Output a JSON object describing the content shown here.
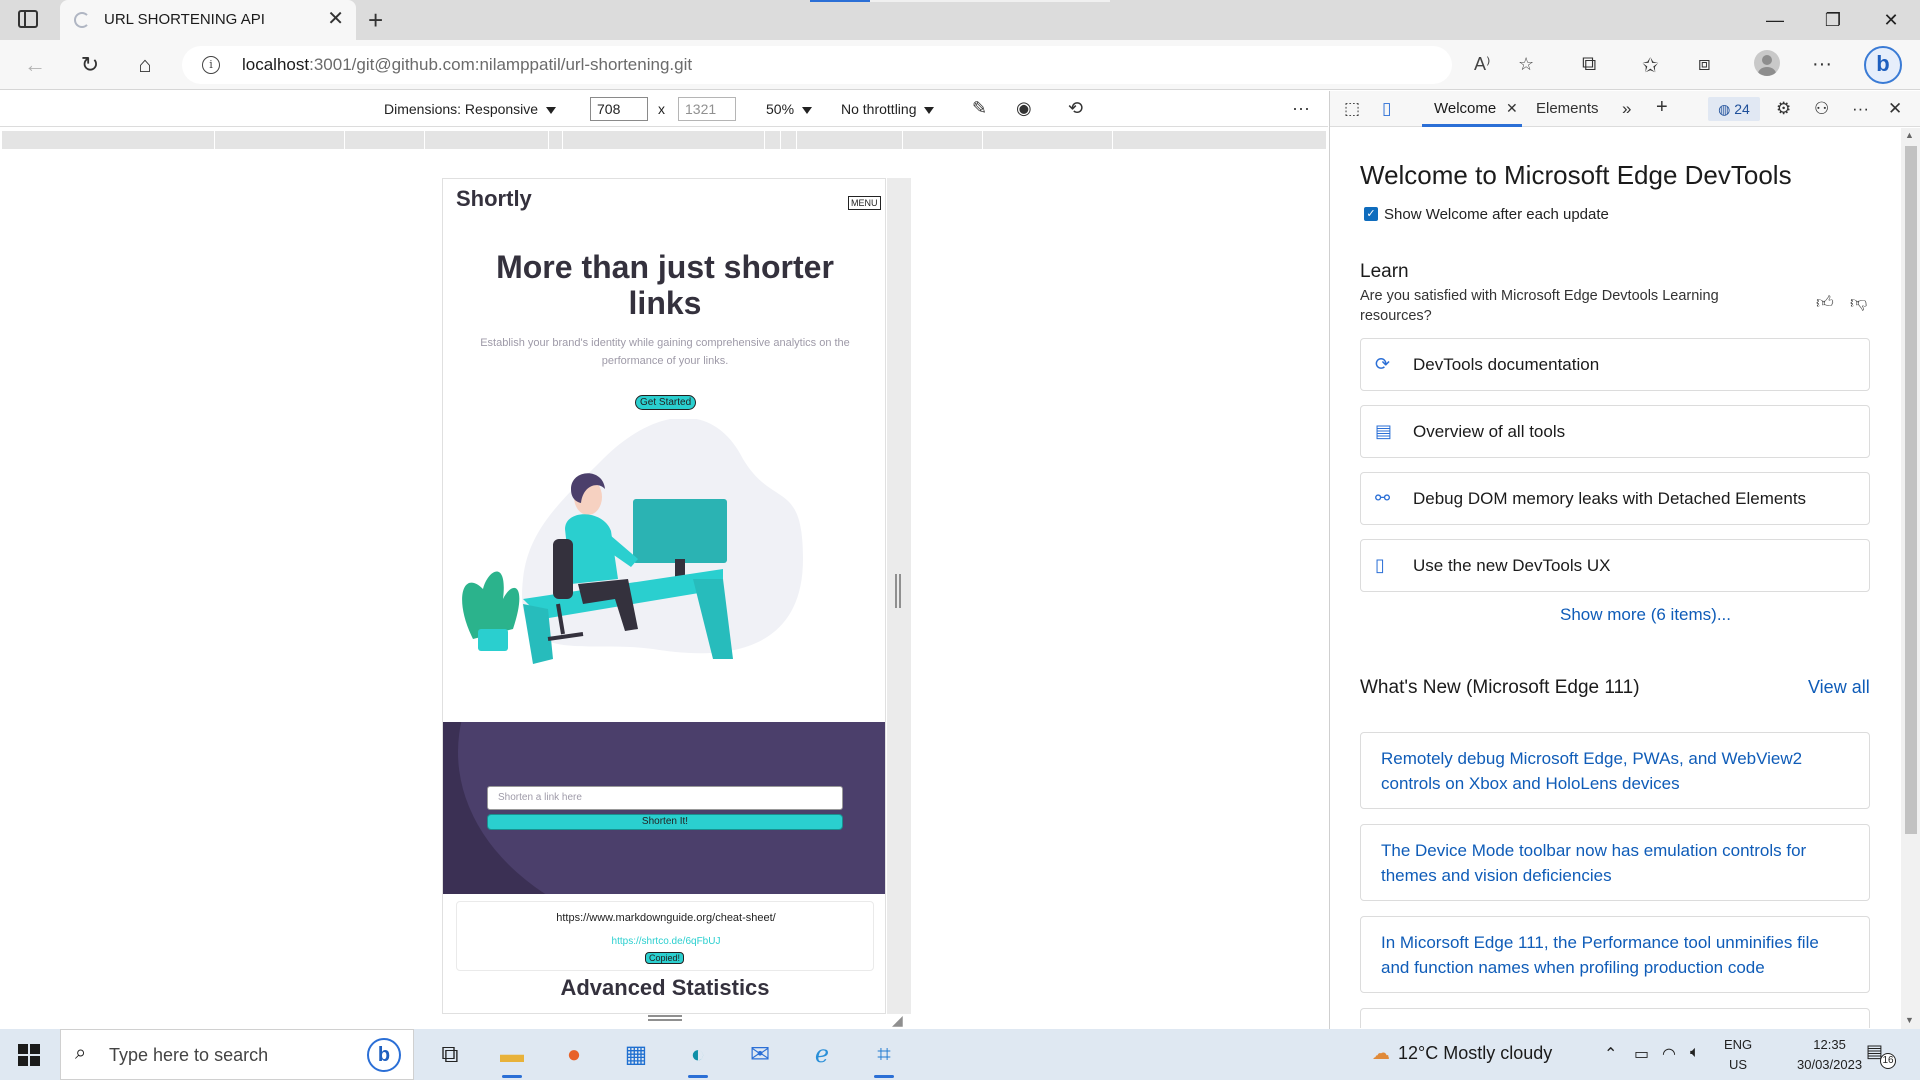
{
  "browser": {
    "tab_title": "URL SHORTENING API",
    "url_host": "localhost",
    "url_rest": ":3001/git@github.com:nilamppatil/url-shortening.git"
  },
  "device_toolbar": {
    "dimensions_label": "Dimensions: Responsive",
    "width": "708",
    "height": "1321",
    "zoom": "50%",
    "throttling": "No throttling"
  },
  "page": {
    "logo": "Shortly",
    "menu_label": "MENU",
    "hero_title": "More than just shorter links",
    "hero_subtitle": "Establish your brand's identity while gaining comprehensive analytics on the performance of your links.",
    "get_started": "Get Started",
    "input_placeholder": "Shorten a link here",
    "shorten_button": "Shorten It!",
    "result_original": "https://www.markdownguide.org/cheat-sheet/",
    "result_short": "https://shrtco.de/6qFbUJ",
    "copied_label": "Copied!",
    "section_title": "Advanced Statistics",
    "colors": {
      "cyan": "#2acfcf",
      "dark_violet": "#3b3054",
      "text_dark": "#34313d",
      "text_gray": "#9e9aa8"
    }
  },
  "devtools": {
    "tabs": [
      {
        "label": "Welcome"
      },
      {
        "label": "Elements"
      }
    ],
    "issues_count": "24",
    "welcome_title": "Welcome to Microsoft Edge DevTools",
    "show_welcome_label": "Show Welcome after each update",
    "learn_title": "Learn",
    "learn_question": "Are you satisfied with Microsoft Edge Devtools Learning resources?",
    "learn_items": [
      {
        "label": "DevTools documentation",
        "icon": "docs-icon"
      },
      {
        "label": "Overview of all tools",
        "icon": "document-icon"
      },
      {
        "label": "Debug DOM memory leaks with Detached Elements",
        "icon": "detached-elements-icon"
      },
      {
        "label": "Use the new DevTools UX",
        "icon": "panel-icon"
      }
    ],
    "show_more": "Show more (6 items)...",
    "whats_new_title": "What's New (Microsoft Edge 111)",
    "view_all": "View all",
    "news_items": [
      {
        "label": "Remotely debug Microsoft Edge, PWAs, and WebView2 controls on Xbox and HoloLens devices"
      },
      {
        "label": "The Device Mode toolbar now has emulation controls for themes and vision deficiencies"
      },
      {
        "label": "In Micorsoft Edge 111, the Performance tool unminifies file and function names when profiling production code"
      }
    ]
  },
  "taskbar": {
    "search_placeholder": "Type here to search",
    "weather": "12°C  Mostly cloudy",
    "lang_line1": "ENG",
    "lang_line2": "US",
    "time": "12:35",
    "date": "30/03/2023",
    "notification_count": "16"
  }
}
